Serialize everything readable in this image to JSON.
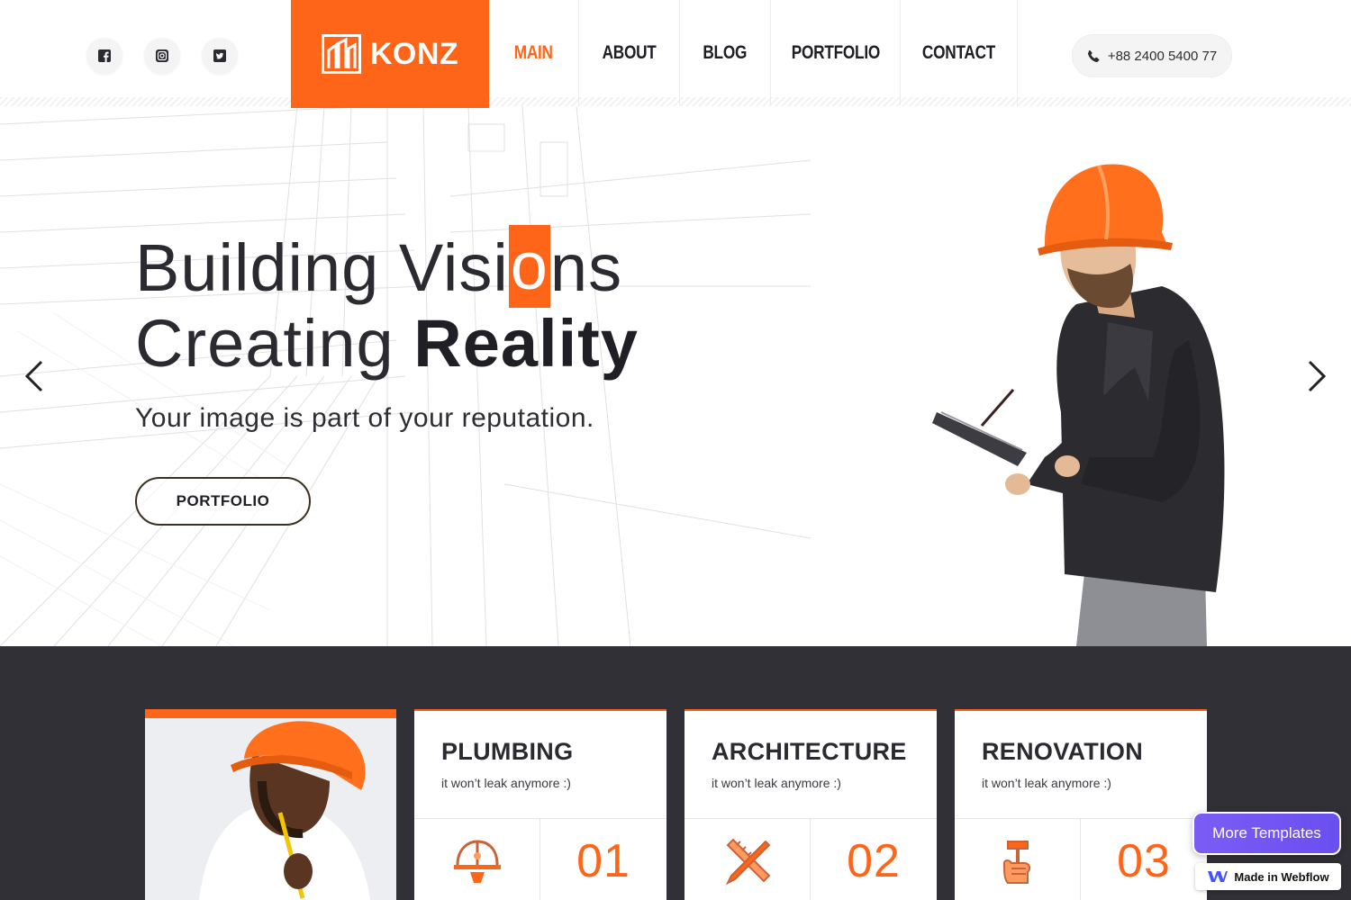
{
  "header": {
    "socials": [
      {
        "name": "facebook-icon"
      },
      {
        "name": "instagram-icon"
      },
      {
        "name": "twitter-icon"
      }
    ],
    "logo_text": "KONZ",
    "nav": [
      {
        "label": "MAIN",
        "active": true
      },
      {
        "label": "ABOUT",
        "active": false
      },
      {
        "label": "BLOG",
        "active": false
      },
      {
        "label": "PORTFOLIO",
        "active": false
      },
      {
        "label": "CONTACT",
        "active": false
      }
    ],
    "phone": "+88 2400 5400 77"
  },
  "hero": {
    "title_part1": "Building Visi",
    "title_highlight": "o",
    "title_part2": "ns",
    "title_line2_regular": "Creating ",
    "title_line2_bold": "Reality",
    "subtitle": "Your image is part of your reputation.",
    "button_label": "PORTFOLIO"
  },
  "services": [
    {
      "title": "PLUMBING",
      "desc": "it won’t leak anymore :)",
      "number": "01",
      "icon": "hard-hat-icon"
    },
    {
      "title": "ARCHITECTURE",
      "desc": "it won’t leak anymore :)",
      "number": "02",
      "icon": "pencil-ruler-icon"
    },
    {
      "title": "RENOVATION",
      "desc": "it won’t leak anymore :)",
      "number": "03",
      "icon": "hammer-hand-icon"
    }
  ],
  "badges": {
    "more_templates": "More Templates",
    "made_in_webflow": "Made in Webflow"
  },
  "colors": {
    "accent": "#ff6519",
    "dark": "#303036"
  }
}
